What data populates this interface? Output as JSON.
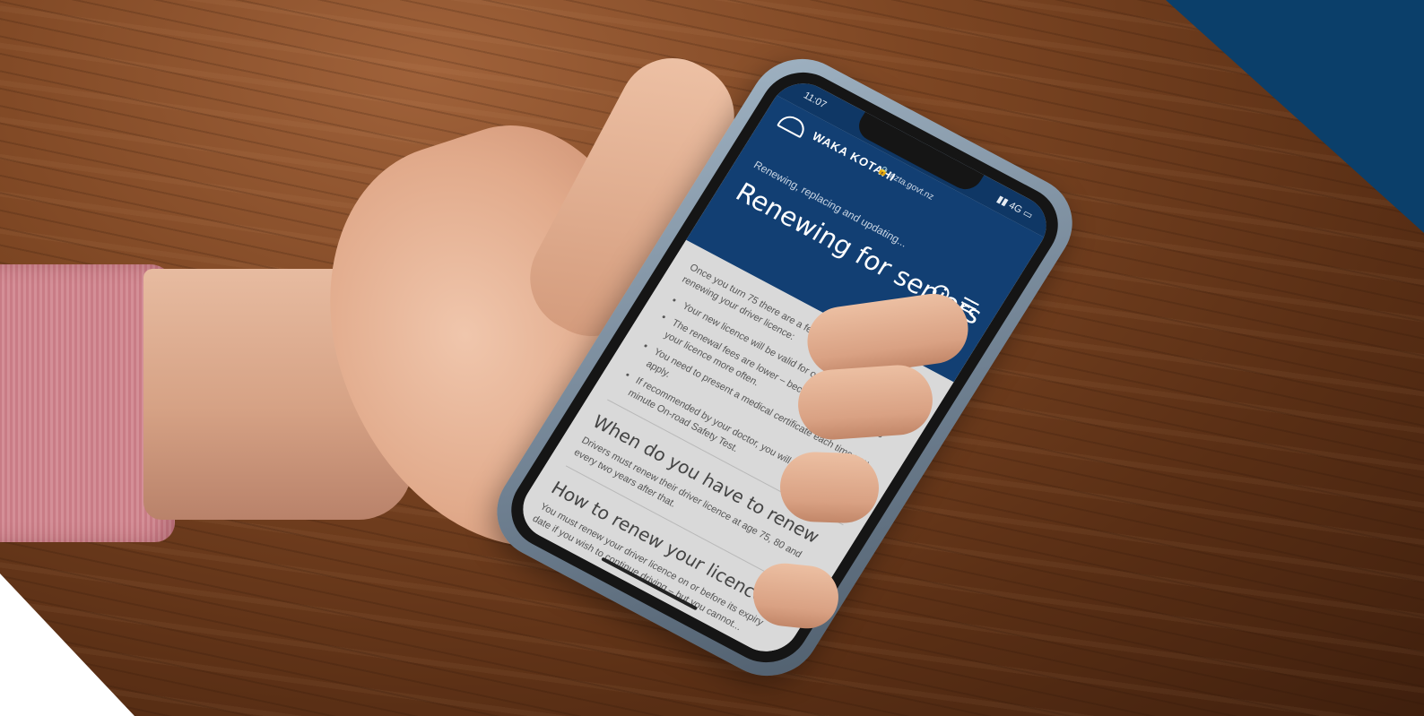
{
  "colors": {
    "corner_accent": "#0b3f6a",
    "site_header": "#123f73",
    "screen_background": "#d9d9d9"
  },
  "phone": {
    "status_time": "11:07",
    "status_icons": "▮▮ 4G ▭",
    "url": "🔒 nzta.govt.nz"
  },
  "site": {
    "logo_text": "WAKA KOTAHI",
    "breadcrumb": "Renewing, replacing and updating...",
    "page_title": "Renewing for seniors",
    "icons": [
      "search-icon",
      "menu-icon"
    ]
  },
  "content": {
    "intro": "Once you turn 75 there are a few changes to the process for renewing your driver licence:",
    "bullets": [
      "Your new licence will be valid for only two to five years.",
      "The renewal fees are lower – because you're renewing your licence more often.",
      "You need to present a medical certificate each time you apply.",
      "If recommended by your doctor, you will have to sit a 30 minute On-road Safety Test."
    ],
    "section1_heading": "When do you have to renew",
    "section1_text": "Drivers must renew their driver licence at age 75, 80 and every two years after that.",
    "section2_heading": "How to renew your licence",
    "section2_text": "You must renew your driver licence on or before its expiry date if you wish to continue driving – but you cannot..."
  }
}
